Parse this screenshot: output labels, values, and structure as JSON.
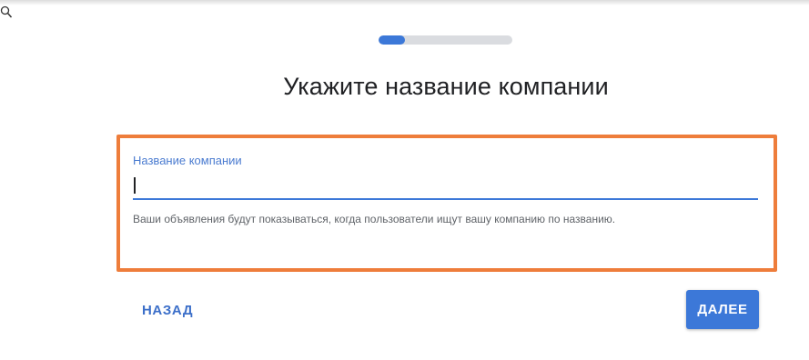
{
  "progress": {
    "fraction": 0.2,
    "fill_color": "#3c78d8",
    "track_color": "#dadce0"
  },
  "page": {
    "title": "Укажите название компании"
  },
  "company_field": {
    "label": "Название компании",
    "value": "",
    "helper": "Ваши объявления будут показываться, когда пользователи ищут вашу компанию по названию."
  },
  "highlight_color": "#ee7d3b",
  "actions": {
    "back_label": "НАЗАД",
    "next_label": "ДАЛЕЕ"
  },
  "cursor_icon": "magnifier-cursor-icon"
}
